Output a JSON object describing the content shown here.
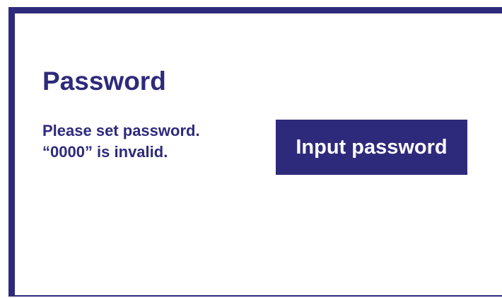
{
  "dialog": {
    "title": "Password",
    "message_line1": "Please set password.",
    "message_line2": "“0000” is invalid.",
    "input_button_label": "Input password"
  },
  "colors": {
    "accent": "#2e2a7b",
    "background": "#ffffff",
    "button_text": "#ffffff"
  }
}
